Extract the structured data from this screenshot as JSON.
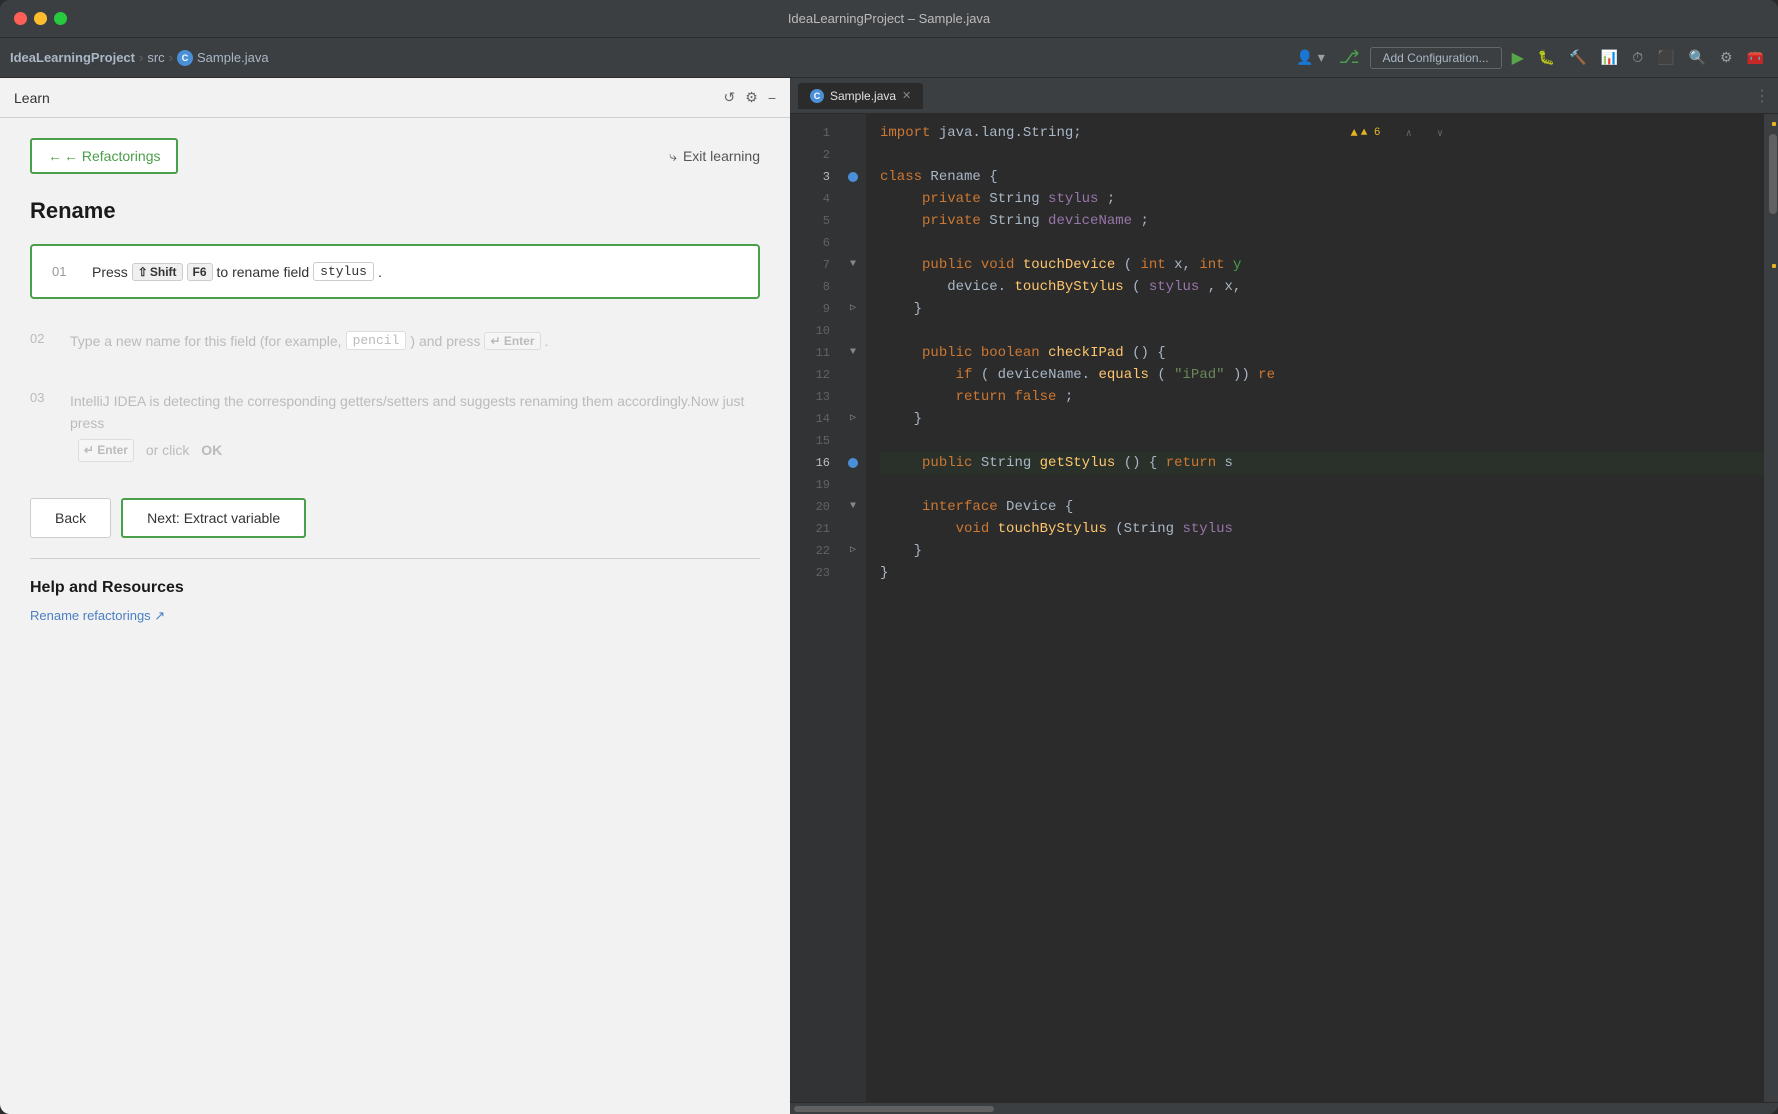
{
  "window": {
    "title": "IdeaLearningProject – Sample.java"
  },
  "titlebar": {
    "title": "IdeaLearningProject – Sample.java"
  },
  "toolbar": {
    "breadcrumb": {
      "project": "IdeaLearningProject",
      "src": "src",
      "file": "Sample.java"
    },
    "add_config_label": "Add Configuration...",
    "warning_count": "▲ 6"
  },
  "learn_panel": {
    "header_title": "Learn",
    "refactorings_btn": "← Refactorings",
    "exit_btn": "Exit learning",
    "section_title": "Rename",
    "step01": {
      "number": "01",
      "text_before": "Press",
      "shift_key": "⇧ Shift",
      "f6_key": "F6",
      "text_after": "to rename field",
      "field_name": "stylus",
      "dot": "."
    },
    "step02": {
      "number": "02",
      "text": "Type a new name for this field (for example,",
      "example": "pencil",
      "text2": ") and press",
      "enter_key": "↵ Enter",
      "dot": "."
    },
    "step03": {
      "number": "03",
      "text1": "IntelliJ IDEA is detecting the corresponding getters/setters and suggests renaming them accordingly.Now just press",
      "enter_key": "↵ Enter",
      "text2": "or click",
      "ok": "OK"
    },
    "back_btn": "Back",
    "next_btn": "Next: Extract variable",
    "help_title": "Help and Resources",
    "help_link": "Rename refactorings ↗"
  },
  "editor": {
    "tab_label": "Sample.java",
    "lines": [
      {
        "num": 1,
        "active": false,
        "content": "import java.lang.String;",
        "tokens": [
          {
            "t": "kw",
            "v": "import"
          },
          {
            "t": "plain",
            "v": " java.lang.String;"
          }
        ]
      },
      {
        "num": 2,
        "active": false,
        "content": "",
        "tokens": []
      },
      {
        "num": 3,
        "active": true,
        "content": "class Rename {",
        "tokens": [
          {
            "t": "kw",
            "v": "class"
          },
          {
            "t": "plain",
            "v": " Rename {"
          }
        ]
      },
      {
        "num": 4,
        "active": false,
        "content": "    private String stylus;",
        "tokens": [
          {
            "t": "plain",
            "v": "    "
          },
          {
            "t": "kw",
            "v": "private"
          },
          {
            "t": "plain",
            "v": " String stylus;"
          }
        ]
      },
      {
        "num": 5,
        "active": false,
        "content": "    private String deviceName;",
        "tokens": [
          {
            "t": "plain",
            "v": "    "
          },
          {
            "t": "kw",
            "v": "private"
          },
          {
            "t": "plain",
            "v": " String deviceName;"
          }
        ]
      },
      {
        "num": 6,
        "active": false,
        "content": "",
        "tokens": []
      },
      {
        "num": 7,
        "active": false,
        "content": "    public void touchDevice(int x, int y",
        "tokens": [
          {
            "t": "plain",
            "v": "    "
          },
          {
            "t": "kw",
            "v": "public"
          },
          {
            "t": "plain",
            "v": " "
          },
          {
            "t": "kw",
            "v": "void"
          },
          {
            "t": "plain",
            "v": " "
          },
          {
            "t": "method",
            "v": "touchDevice"
          },
          {
            "t": "plain",
            "v": "("
          },
          {
            "t": "kw",
            "v": "int"
          },
          {
            "t": "plain",
            "v": " x, "
          },
          {
            "t": "kw",
            "v": "int"
          },
          {
            "t": "plain",
            "v": " y"
          }
        ]
      },
      {
        "num": 8,
        "active": false,
        "content": "        device.touchByStylus(stylus, x,",
        "tokens": [
          {
            "t": "plain",
            "v": "        device."
          },
          {
            "t": "method",
            "v": "touchByStylus"
          },
          {
            "t": "plain",
            "v": "("
          },
          {
            "t": "field",
            "v": "stylus"
          },
          {
            "t": "plain",
            "v": ", x,"
          }
        ]
      },
      {
        "num": 9,
        "active": false,
        "content": "    }",
        "tokens": [
          {
            "t": "plain",
            "v": "    }"
          }
        ]
      },
      {
        "num": 10,
        "active": false,
        "content": "",
        "tokens": []
      },
      {
        "num": 11,
        "active": false,
        "content": "    public boolean checkIPad() {",
        "tokens": [
          {
            "t": "plain",
            "v": "    "
          },
          {
            "t": "kw",
            "v": "public"
          },
          {
            "t": "plain",
            "v": " "
          },
          {
            "t": "kw",
            "v": "boolean"
          },
          {
            "t": "plain",
            "v": " "
          },
          {
            "t": "method",
            "v": "checkIPad"
          },
          {
            "t": "plain",
            "v": "() {"
          }
        ]
      },
      {
        "num": 12,
        "active": false,
        "content": "        if (deviceName.equals(\"iPad\")) r",
        "tokens": [
          {
            "t": "plain",
            "v": "        "
          },
          {
            "t": "kw",
            "v": "if"
          },
          {
            "t": "plain",
            "v": " (deviceName."
          },
          {
            "t": "method",
            "v": "equals"
          },
          {
            "t": "plain",
            "v": "("
          },
          {
            "t": "str",
            "v": "\"iPad\""
          },
          {
            "t": "plain",
            "v": "}) r"
          }
        ]
      },
      {
        "num": 13,
        "active": false,
        "content": "        return false;",
        "tokens": [
          {
            "t": "plain",
            "v": "        "
          },
          {
            "t": "kw",
            "v": "return"
          },
          {
            "t": "plain",
            "v": " "
          },
          {
            "t": "kw",
            "v": "false"
          },
          {
            "t": "plain",
            "v": ";"
          }
        ]
      },
      {
        "num": 14,
        "active": false,
        "content": "    }",
        "tokens": [
          {
            "t": "plain",
            "v": "    }"
          }
        ]
      },
      {
        "num": 15,
        "active": false,
        "content": "",
        "tokens": []
      },
      {
        "num": 16,
        "active": true,
        "content": "    public String getStylus() { return s",
        "tokens": [
          {
            "t": "plain",
            "v": "    "
          },
          {
            "t": "kw",
            "v": "public"
          },
          {
            "t": "plain",
            "v": " String "
          },
          {
            "t": "method",
            "v": "getStylus"
          },
          {
            "t": "plain",
            "v": "() { "
          },
          {
            "t": "kw",
            "v": "return"
          },
          {
            "t": "plain",
            "v": " s"
          }
        ]
      },
      {
        "num": 19,
        "active": false,
        "content": "",
        "tokens": []
      },
      {
        "num": 20,
        "active": false,
        "content": "    interface Device {",
        "tokens": [
          {
            "t": "plain",
            "v": "    "
          },
          {
            "t": "kw",
            "v": "interface"
          },
          {
            "t": "plain",
            "v": " Device {"
          }
        ]
      },
      {
        "num": 21,
        "active": false,
        "content": "        void touchByStylus(String stylus",
        "tokens": [
          {
            "t": "plain",
            "v": "        "
          },
          {
            "t": "kw",
            "v": "void"
          },
          {
            "t": "plain",
            "v": " "
          },
          {
            "t": "method",
            "v": "touchByStylus"
          },
          {
            "t": "plain",
            "v": "(String stylus"
          }
        ]
      },
      {
        "num": 22,
        "active": false,
        "content": "    }",
        "tokens": [
          {
            "t": "plain",
            "v": "    }"
          }
        ]
      },
      {
        "num": 23,
        "active": false,
        "content": "}",
        "tokens": [
          {
            "t": "plain",
            "v": "}"
          }
        ]
      }
    ]
  }
}
